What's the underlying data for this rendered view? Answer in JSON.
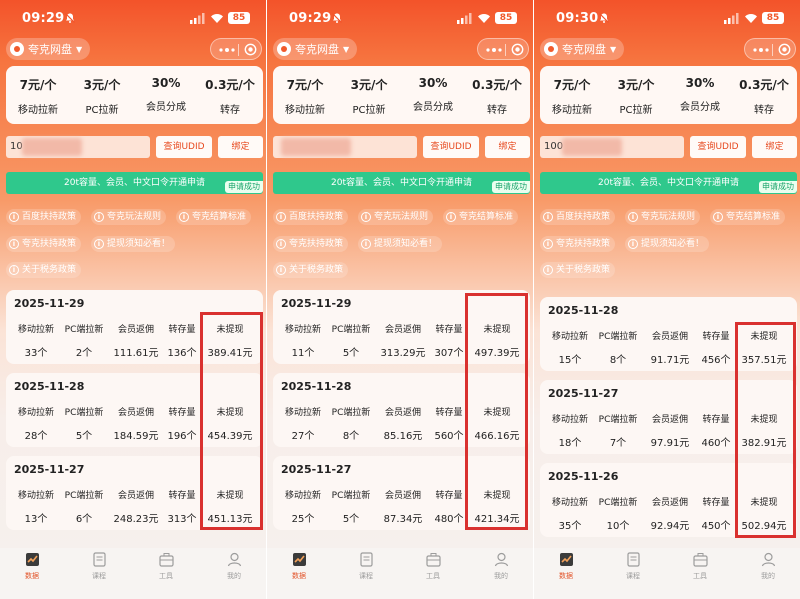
{
  "colors": {
    "brand_orange": "#f3532a",
    "banner_green": "#2fc88c",
    "highlight_red": "#d9312f",
    "tab_active": "#e2542a"
  },
  "app": {
    "name": "夸克网盘",
    "more_icon": "dots-icon",
    "close_icon": "target-icon"
  },
  "shared": {
    "rates": [
      {
        "value": "7元/个",
        "label": "移动拉新"
      },
      {
        "value": "3元/个",
        "label": "PC拉新"
      },
      {
        "value": "30%",
        "label": "会员分成"
      },
      {
        "value": "0.3元/个",
        "label": "转存"
      }
    ],
    "query_button": "查询UDID",
    "bind_button": "绑定",
    "banner_text": "20t容量、会员、中文口令开通申请",
    "banner_badge": "申请成功",
    "policies": [
      "百度扶持政策",
      "夸克玩法规则",
      "夸克结算标准",
      "夸克扶持政策",
      "提现须知必看！",
      "关于税务政策"
    ],
    "stat_labels": [
      "移动拉新",
      "PC端拉新",
      "会员返佣",
      "转存量",
      "未提现"
    ],
    "tabs": [
      {
        "label": "数据",
        "icon": "chart-icon"
      },
      {
        "label": "课程",
        "icon": "book-icon"
      },
      {
        "label": "工具",
        "icon": "toolbox-icon"
      },
      {
        "label": "我的",
        "icon": "user-icon"
      }
    ]
  },
  "screens": [
    {
      "time": "09:29",
      "battery": "85",
      "udid_value": "10",
      "days": [
        {
          "date": "2025-11-29",
          "mobile": "33个",
          "pc": "2个",
          "rebate": "111.61元",
          "transfer": "136个",
          "unwithdrawn": "389.41元"
        },
        {
          "date": "2025-11-28",
          "mobile": "28个",
          "pc": "5个",
          "rebate": "184.59元",
          "transfer": "196个",
          "unwithdrawn": "454.39元"
        },
        {
          "date": "2025-11-27",
          "mobile": "13个",
          "pc": "6个",
          "rebate": "248.23元",
          "transfer": "313个",
          "unwithdrawn": "451.13元"
        }
      ]
    },
    {
      "time": "09:29",
      "battery": "85",
      "udid_value": "",
      "days": [
        {
          "date": "2025-11-29",
          "mobile": "11个",
          "pc": "5个",
          "rebate": "313.29元",
          "transfer": "307个",
          "unwithdrawn": "497.39元"
        },
        {
          "date": "2025-11-28",
          "mobile": "27个",
          "pc": "8个",
          "rebate": "85.16元",
          "transfer": "560个",
          "unwithdrawn": "466.16元"
        },
        {
          "date": "2025-11-27",
          "mobile": "25个",
          "pc": "5个",
          "rebate": "87.34元",
          "transfer": "480个",
          "unwithdrawn": "421.34元"
        }
      ]
    },
    {
      "time": "09:30",
      "battery": "85",
      "udid_value": "100",
      "days": [
        {
          "date": "2025-11-28",
          "mobile": "15个",
          "pc": "8个",
          "rebate": "91.71元",
          "transfer": "456个",
          "unwithdrawn": "357.51元"
        },
        {
          "date": "2025-11-27",
          "mobile": "18个",
          "pc": "7个",
          "rebate": "97.91元",
          "transfer": "460个",
          "unwithdrawn": "382.91元"
        },
        {
          "date": "2025-11-26",
          "mobile": "35个",
          "pc": "10个",
          "rebate": "92.94元",
          "transfer": "450个",
          "unwithdrawn": "502.94元"
        }
      ]
    }
  ]
}
